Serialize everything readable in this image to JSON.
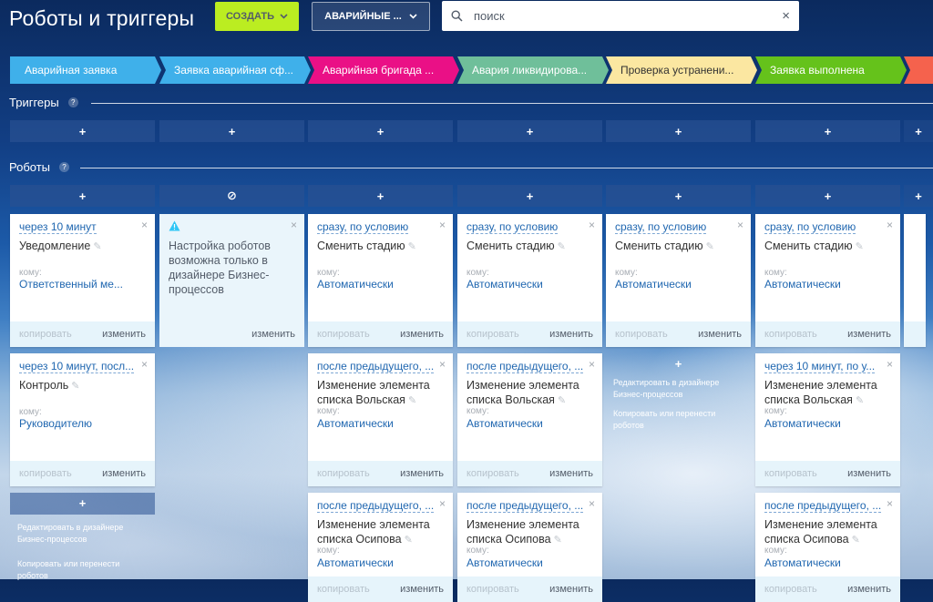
{
  "header": {
    "title": "Роботы и триггеры",
    "create_label": "СОЗДАТЬ",
    "category_label": "АВАРИЙНЫЕ ...",
    "search_placeholder": "поиск"
  },
  "stages": [
    {
      "label": "Аварийная заявка",
      "color": "#3fb0ea",
      "text_color": "#ffffff"
    },
    {
      "label": "Заявка аварийная сф...",
      "color": "#3fb0ea",
      "text_color": "#ffffff"
    },
    {
      "label": "Аварийная бригада ...",
      "color": "#ea1086",
      "text_color": "#ffffff"
    },
    {
      "label": "Авария ликвидирова...",
      "color": "#6fbf9a",
      "text_color": "#ffffff"
    },
    {
      "label": "Проверка устранени...",
      "color": "#fbe7a1",
      "text_color": "#333333"
    },
    {
      "label": "Заявка выполнена",
      "color": "#65c21b",
      "text_color": "#ffffff"
    },
    {
      "label": "",
      "color": "#f5624d",
      "text_color": "#ffffff"
    }
  ],
  "sections": {
    "triggers": "Триггеры",
    "robots": "Роботы",
    "help": "?"
  },
  "glyphs": {
    "plus": "+",
    "blocked": "⊘",
    "close": "×",
    "pencil": "✎"
  },
  "labels": {
    "to": "кому:",
    "copy": "копировать",
    "edit": "изменить",
    "edit_in_designer": "Редактировать в дизайнере Бизнес-процессов",
    "copy_or_move": "Копировать или перенести роботов"
  },
  "robots": {
    "col1": [
      {
        "when": "через 10 минут",
        "name": "Уведомление",
        "to": "Ответственный ме..."
      },
      {
        "when": "через 10 минут, посл...",
        "name": "Контроль",
        "to": "Руководителю"
      }
    ],
    "col2_info": "Настройка роботов возможна только в дизайнере Бизнес-процессов",
    "col3": [
      {
        "when": "сразу, по условию",
        "name": "Сменить стадию",
        "to": "Автоматически"
      },
      {
        "when": "после предыдущего, ...",
        "name": "Изменение элемента списка Вольская",
        "to": "Автоматически"
      },
      {
        "when": "после предыдущего, ...",
        "name": "Изменение элемента списка Осипова",
        "to": "Автоматически"
      }
    ],
    "col4": [
      {
        "when": "сразу, по условию",
        "name": "Сменить стадию",
        "to": "Автоматически"
      },
      {
        "when": "после предыдущего, ...",
        "name": "Изменение элемента списка Вольская",
        "to": "Автоматически"
      },
      {
        "when": "после предыдущего, ...",
        "name": "Изменение элемента списка Осипова",
        "to": "Автоматически"
      }
    ],
    "col5": [
      {
        "when": "сразу, по условию",
        "name": "Сменить стадию",
        "to": "Автоматически"
      }
    ],
    "col6": [
      {
        "when": "сразу, по условию",
        "name": "Сменить стадию",
        "to": "Автоматически"
      },
      {
        "when": "через 10 минут, по у...",
        "name": "Изменение элемента списка Вольская",
        "to": "Автоматически"
      },
      {
        "when": "после предыдущего, ...",
        "name": "Изменение элемента списка Осипова",
        "to": "Автоматически"
      }
    ]
  }
}
